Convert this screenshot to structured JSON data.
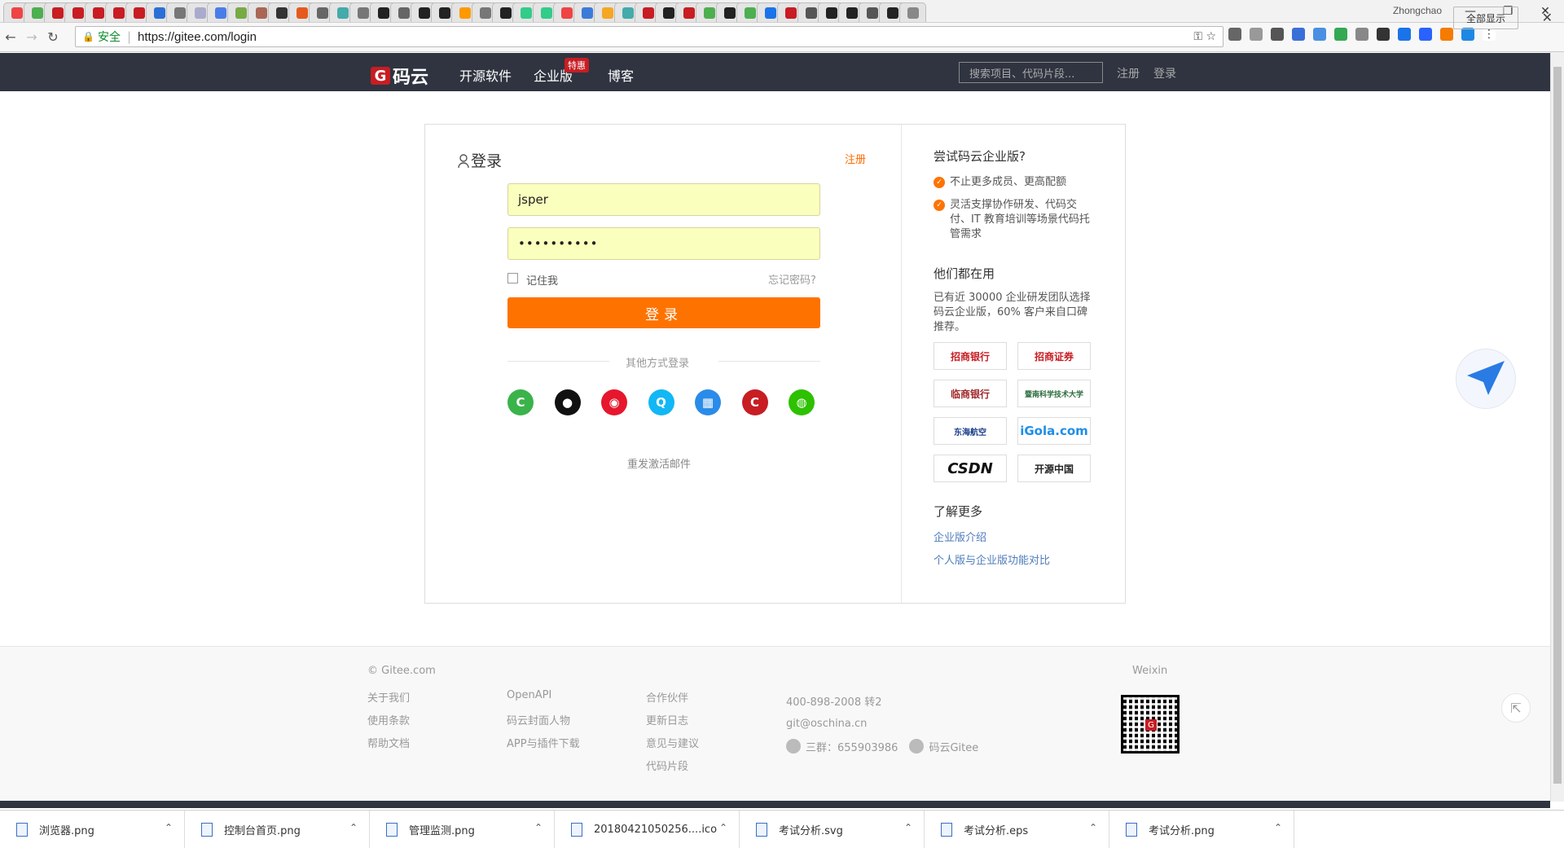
{
  "browser": {
    "user": "Zhongchao",
    "tab_colors": [
      "#e44",
      "#4caf50",
      "#c71d23",
      "#c71d23",
      "#c71d23",
      "#c71d23",
      "#c71d23",
      "#2b6fd6",
      "#777",
      "#aac",
      "#4a7de8",
      "#7a4",
      "#a65",
      "#333",
      "#e55a1c",
      "#666",
      "#4aa",
      "#777",
      "#222",
      "#666",
      "#222",
      "#222",
      "#f90",
      "#777",
      "#222",
      "#3c8",
      "#3c8",
      "#e44",
      "#3b7bd8",
      "#f5a623",
      "#4aa",
      "#c71d23",
      "#222",
      "#c71d23",
      "#4caf50",
      "#222",
      "#4caf50",
      "#1a73e8",
      "#c71d23",
      "#555",
      "#222",
      "#222",
      "#555",
      "#222",
      "#888"
    ],
    "address": {
      "secure_label": "安全",
      "url": "https://gitee.com/login"
    },
    "window_controls": [
      "—",
      "❐",
      "✕"
    ]
  },
  "header": {
    "logo_letter": "G",
    "logo_text": "码云",
    "nav": [
      "开源软件",
      "企业版",
      "博客"
    ],
    "badge": "特惠",
    "search_placeholder": "搜索项目、代码片段...",
    "register": "注册",
    "login": "登录"
  },
  "login": {
    "title": "登录",
    "register_link": "注册",
    "username": "jsper",
    "password": "••••••••••",
    "remember": "记住我",
    "forgot": "忘记密码?",
    "submit": "登录",
    "other_methods": "其他方式登录",
    "resend": "重发激活邮件",
    "social": [
      {
        "name": "gitee",
        "color": "#3ab34a",
        "glyph": "C"
      },
      {
        "name": "github",
        "color": "#111",
        "glyph": "●"
      },
      {
        "name": "weibo",
        "color": "#e6162d",
        "glyph": "◉"
      },
      {
        "name": "qq",
        "color": "#12b7f5",
        "glyph": "Q"
      },
      {
        "name": "windows",
        "color": "#2b8be8",
        "glyph": "▦"
      },
      {
        "name": "csdn",
        "color": "#c71d23",
        "glyph": "C"
      },
      {
        "name": "wechat",
        "color": "#2dc100",
        "glyph": "◍"
      }
    ]
  },
  "sidebar": {
    "try_title": "尝试码云企业版?",
    "features": [
      "不止更多成员、更高配额",
      "灵活支撑协作研发、代码交付、IT 教育培训等场景代码托管需求"
    ],
    "users_title": "他们都在用",
    "users_desc": "已有近 30000 企业研发团队选择码云企业版，60% 客户来自口碑推荐。",
    "brands": [
      "招商银行",
      "招商证券",
      "临商银行",
      "暨南科学技术大学",
      "东海航空",
      "iGola.com",
      "CSDN",
      "开源中国"
    ],
    "more_title": "了解更多",
    "links": [
      "企业版介绍",
      "个人版与企业版功能对比"
    ]
  },
  "footer": {
    "copyright": "© Gitee.com",
    "col1": [
      "关于我们",
      "使用条款",
      "帮助文档"
    ],
    "col2": [
      "OpenAPI",
      "码云封面人物",
      "APP与插件下载"
    ],
    "col3": [
      "合作伙伴",
      "更新日志",
      "意见与建议",
      "代码片段"
    ],
    "phone": "400-898-2008 转2",
    "email": "git@oschina.cn",
    "qq_group": "三群：655903986",
    "weibo": "码云Gitee",
    "weixin": "Weixin"
  },
  "downloads": {
    "items": [
      "浏览器.png",
      "控制台首页.png",
      "管理监测.png",
      "20180421050256....ico",
      "考试分析.svg",
      "考试分析.eps",
      "考试分析.png"
    ],
    "show_all": "全部显示"
  }
}
